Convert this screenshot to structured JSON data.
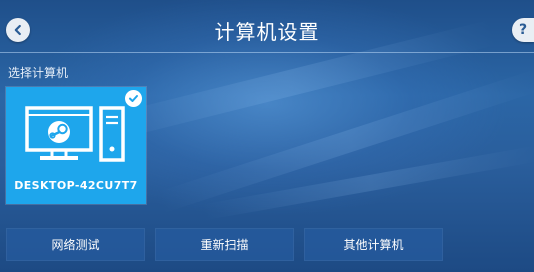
{
  "header": {
    "title": "计算机设置",
    "back_icon": "chevron-left-icon",
    "help_label": "?"
  },
  "section": {
    "label": "选择计算机"
  },
  "computers": [
    {
      "name": "DESKTOP-42CU7T7",
      "selected": true,
      "icon": "desktop-computer-steam-icon"
    }
  ],
  "actions": {
    "network_test": "网络测试",
    "rescan": "重新扫描",
    "other_computers": "其他计算机"
  },
  "colors": {
    "tile_accent": "#1ea6ec",
    "background": "#2b66a6"
  }
}
